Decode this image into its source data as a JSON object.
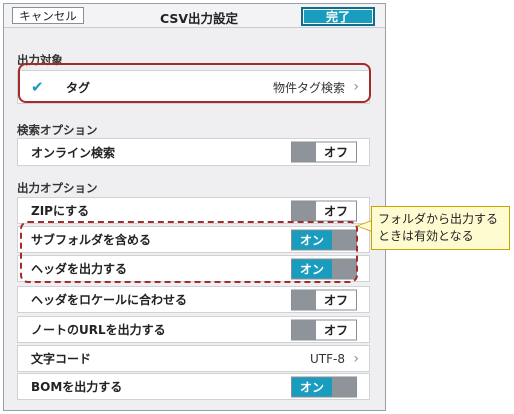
{
  "header": {
    "cancel_label": "キャンセル",
    "title": "CSV出力設定",
    "done_label": "完了"
  },
  "output_target": {
    "section_label": "出力対象",
    "tag_label": "タグ",
    "tag_value": "物件タグ検索",
    "checked": true
  },
  "search_options": {
    "section_label": "検索オプション",
    "online_label": "オンライン検索",
    "online_state": "オフ"
  },
  "output_options": {
    "section_label": "出力オプション",
    "zip_label": "ZIPにする",
    "zip_state": "オフ",
    "subfolder_label": "サブフォルダを含める",
    "subfolder_state": "オン",
    "header_label": "ヘッダを出力する",
    "header_state": "オン",
    "locale_label": "ヘッダをロケールに合わせる",
    "locale_state": "オフ",
    "url_label": "ノートのURLを出力する",
    "url_state": "オフ",
    "charset_label": "文字コード",
    "charset_value": "UTF-8",
    "bom_label": "BOMを出力する",
    "bom_state": "オン"
  },
  "annotation": {
    "callout_text": "フォルダから出力するときは有効となる"
  },
  "colors": {
    "accent": "#1a9cbf",
    "highlight": "#a52a2a",
    "callout_bg": "#fffbd0"
  }
}
